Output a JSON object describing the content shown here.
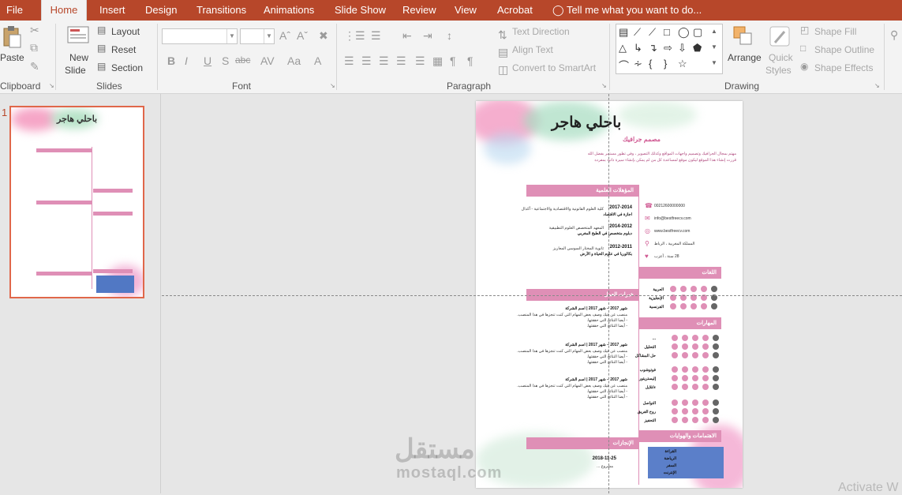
{
  "tabs": {
    "file": "File",
    "home": "Home",
    "insert": "Insert",
    "design": "Design",
    "transitions": "Transitions",
    "animations": "Animations",
    "slideshow": "Slide Show",
    "review": "Review",
    "view": "View",
    "acrobat": "Acrobat",
    "tell_me": "Tell me what you want to do..."
  },
  "ribbon": {
    "clipboard": {
      "paste": "Paste",
      "label": "Clipboard"
    },
    "slides": {
      "new_slide": "New",
      "new_slide2": "Slide",
      "layout": "Layout",
      "reset": "Reset",
      "section": "Section",
      "label": "Slides"
    },
    "font": {
      "label": "Font",
      "bold": "B",
      "italic": "I",
      "underline": "U",
      "strike": "S",
      "spacing": "abc",
      "case": "Aa"
    },
    "paragraph": {
      "text_direction": "Text Direction",
      "align_text": "Align Text",
      "convert_smartart": "Convert to SmartArt",
      "label": "Paragraph"
    },
    "drawing": {
      "arrange": "Arrange",
      "quick_styles": "Quick",
      "quick_styles2": "Styles",
      "shape_fill": "Shape Fill",
      "shape_outline": "Shape Outline",
      "shape_effects": "Shape Effects",
      "label": "Drawing"
    }
  },
  "thumbnail": {
    "slide_number": "1"
  },
  "slide": {
    "name": "باحلي هاجر",
    "job": "مصمم جرافيك",
    "intro1": "مهتم بمجال الجرافيك وتصميم واجهات المواقع وكذلك التصوير ، وفي تطور مستمر بفضل الله",
    "intro2": "قررت إنشاء هذا الموقع ليكون موقع لمساعدة كل من لم يمكن بإنشاء سيرة ذاتية بمفرده",
    "sections": {
      "education": "المؤهلات العلمية",
      "experience": "خبرات العمل",
      "achievements": "الإنجازات",
      "languages": "اللغات",
      "skills": "المهارات",
      "interests": "الاهتمامات والهوايات"
    },
    "education": [
      {
        "year": "2017-2014:",
        "text": "كلية العلوم القانونية والاقتصادية والاجتماعية - أكدال",
        "sub": "اجازة في الاقتصاد"
      },
      {
        "year": "2014-2012:",
        "text": "المعهد المتخصص العلوم التطبيقية",
        "sub": "دبلوم متخصص في الطبخ المغربي"
      },
      {
        "year": "2012-2011:",
        "text": "ثانوية المختار السوسي المعاريز",
        "sub": "بكالوريا في علوم الحياة و الأرض"
      }
    ],
    "experience": [
      {
        "head": "شهر 2017 – شهر 2017 | اسم الشركة",
        "l1": "منصب عن فيك وصف بعض المهام التي كنت تنجزها في هذا المنصب.",
        "l2": "- أيضا النتائج التي حققتها.",
        "l3": "- أيضا النتائج التي حققتها."
      },
      {
        "head": "شهر 2017 – شهر 2017 | اسم الشركة",
        "l1": "منصب عن فيك وصف بعض المهام التي كنت تنجزها في هذا المنصب.",
        "l2": "- أيضا النتائج التي حققتها.",
        "l3": "- أيضا النتائج التي حققتها."
      },
      {
        "head": "شهر 2017 – شهر 2017 | اسم الشركة",
        "l1": "منصب عن فيك وصف بعض المهام التي كنت تنجزها في هذا المنصب.",
        "l2": "- أيضا النتائج التي حققتها.",
        "l3": "- أيضا النتائج التي حققتها."
      }
    ],
    "achievement": {
      "date": "2018-11-25",
      "title": "مشروع ..."
    },
    "contact": {
      "phone": "00212600000000",
      "email": "info@bestfreecv.com",
      "web": "www.bestfreecv.com",
      "address": "المملكة المغربية ، الرباط",
      "age": "28 سنة ، أعزب"
    },
    "languages": [
      "العربية",
      "الإنجليزية",
      "الفرنسية"
    ],
    "skills": [
      "...",
      "التحليل",
      "حل المشاكل",
      "فوتوشوب",
      "إليستريتور",
      "ءانلايل",
      "التواصل",
      "روح الفريق",
      "التحفيز"
    ],
    "interests": [
      "القراءة",
      "الرياضة",
      "السفر",
      "الإنترنت"
    ]
  },
  "watermark": {
    "arabic": "مستقل",
    "latin": "mostaql.com"
  },
  "activate": "Activate W"
}
